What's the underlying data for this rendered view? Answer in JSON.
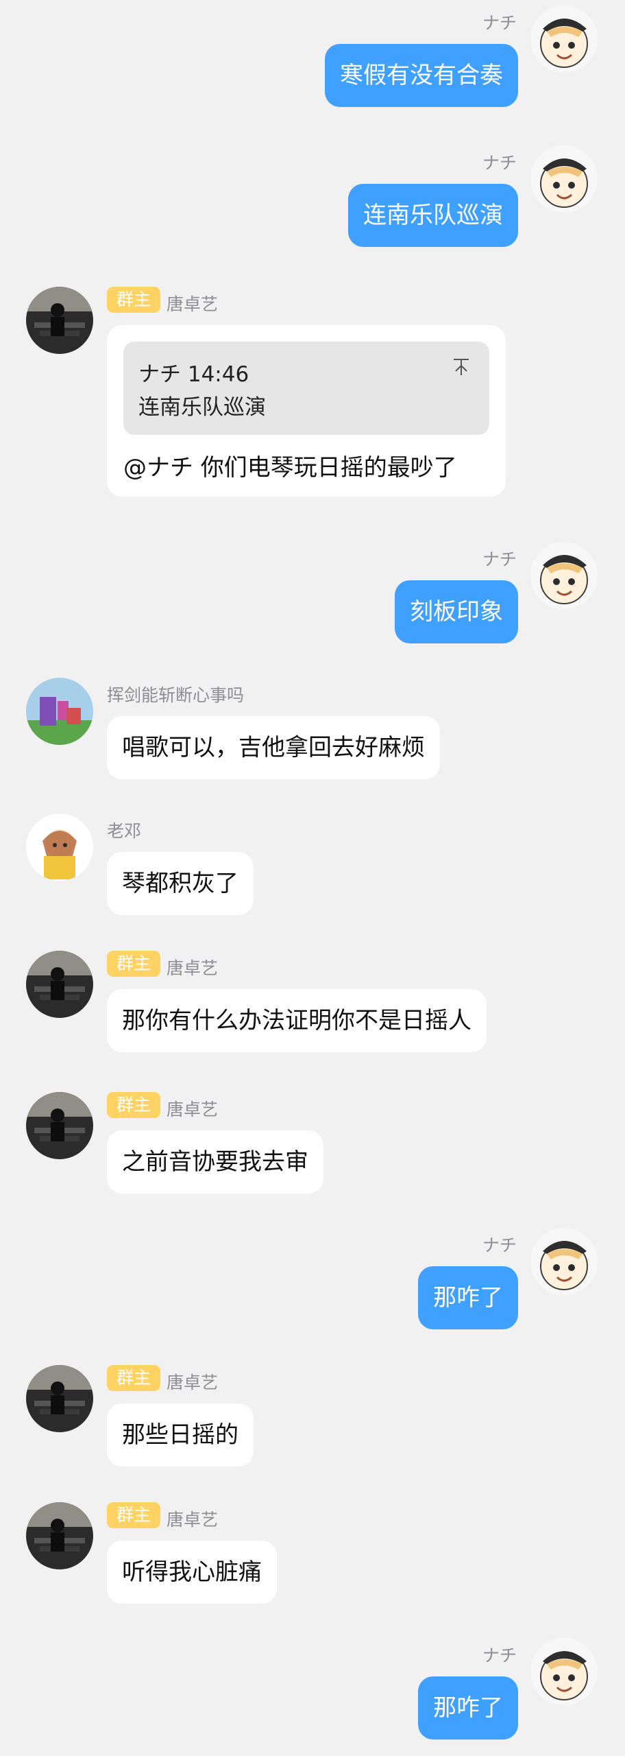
{
  "messages": [
    {
      "sender": "ナチ",
      "text": "寒假有没有合奏"
    },
    {
      "sender": "ナチ",
      "text": "连南乐队巡演"
    },
    {
      "sender": "唐卓艺",
      "badge": "群主",
      "quote": {
        "head": "ナチ 14:46",
        "text": "连南乐队巡演"
      },
      "text": "@ナチ 你们电琴玩日摇的最吵了"
    },
    {
      "sender": "ナチ",
      "text": "刻板印象"
    },
    {
      "sender": "挥剑能斩断心事吗",
      "text": "唱歌可以，吉他拿回去好麻烦"
    },
    {
      "sender": "老邓",
      "text": "琴都积灰了"
    },
    {
      "sender": "唐卓艺",
      "badge": "群主",
      "text": "那你有什么办法证明你不是日摇人"
    },
    {
      "sender": "唐卓艺",
      "badge": "群主",
      "text": "之前音协要我去审"
    },
    {
      "sender": "ナチ",
      "text": "那咋了"
    },
    {
      "sender": "唐卓艺",
      "badge": "群主",
      "text": "那些日摇的"
    },
    {
      "sender": "唐卓艺",
      "badge": "群主",
      "text": "听得我心脏痛"
    },
    {
      "sender": "ナチ",
      "text": "那咋了"
    }
  ],
  "icons": {
    "nachi_avatar": "anime-avatar-icon",
    "tang_avatar": "photo-avatar-icon",
    "quote_icon": "collapse-icon"
  }
}
